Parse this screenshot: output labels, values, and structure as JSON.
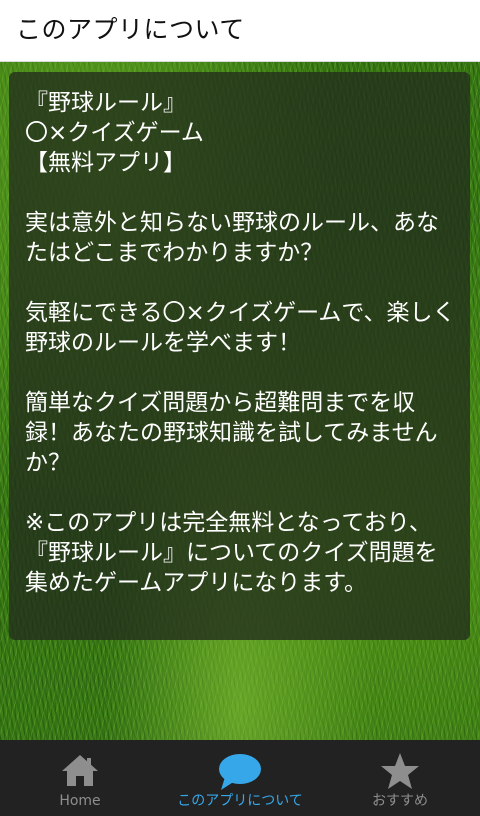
{
  "header": {
    "title": "このアプリについて"
  },
  "panel": {
    "description": "『野球ルール』\n〇×クイズゲーム\n【無料アプリ】\n\n実は意外と知らない野球のルール、あなたはどこまでわかりますか？\n\n気軽にできる〇×クイズゲームで、楽しく野球のルールを学べます！\n\n簡単なクイズ問題から超難問までを収録！あなたの野球知識を試してみませんか？\n\n※このアプリは完全無料となっており、『野球ルール』についてのクイズ問題を集めたゲームアプリになります。"
  },
  "bottom_nav": {
    "items": [
      {
        "label": "Home",
        "icon": "home-icon",
        "active": false
      },
      {
        "label": "このアプリについて",
        "icon": "speech-bubble-icon",
        "active": true
      },
      {
        "label": "おすすめ",
        "icon": "star-icon",
        "active": false
      }
    ]
  },
  "colors": {
    "active": "#36a7e8",
    "inactive": "#8e8e8e",
    "nav_background": "#222222",
    "header_background": "#ffffff"
  }
}
